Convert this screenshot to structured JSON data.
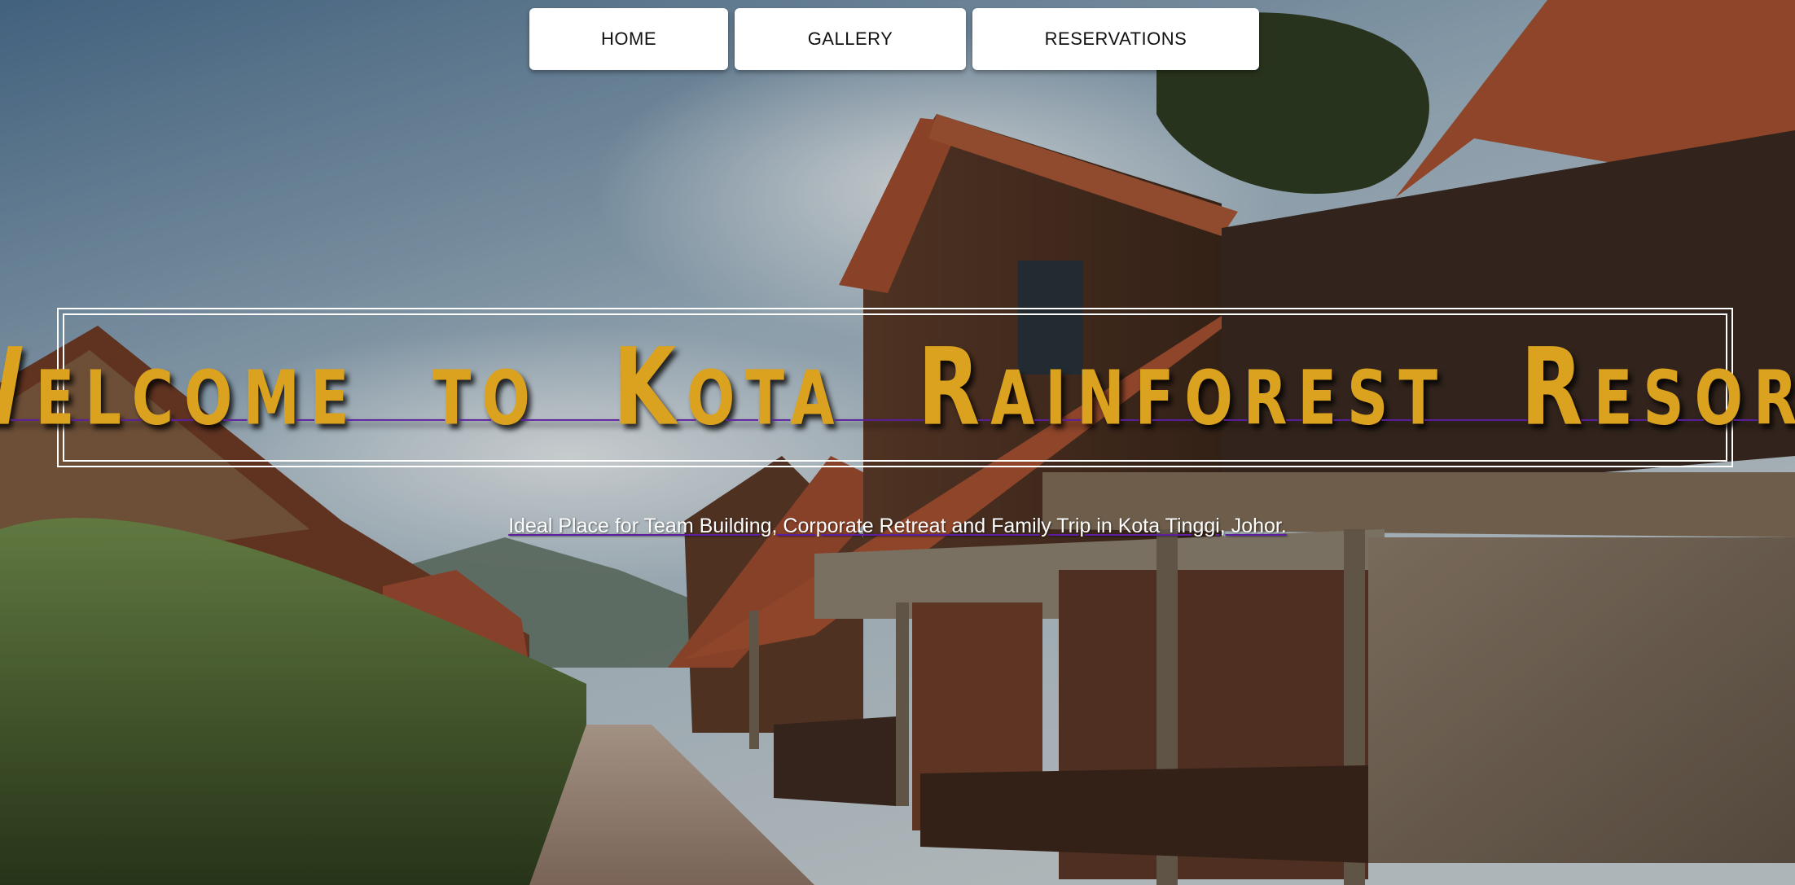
{
  "nav": {
    "home_label": "HOME",
    "gallery_label": "GALLERY",
    "reservations_label": "RESERVATIONS"
  },
  "hero": {
    "title": "Welcome to Kota Rainforest Resort",
    "tagline": "Ideal Place for Team Building, Corporate Retreat and Family Trip in Kota Tinggi, Johor."
  },
  "colors": {
    "title_gold": "#daa21e",
    "underline_purple": "#5b1fa0",
    "nav_bg": "#ffffff"
  }
}
